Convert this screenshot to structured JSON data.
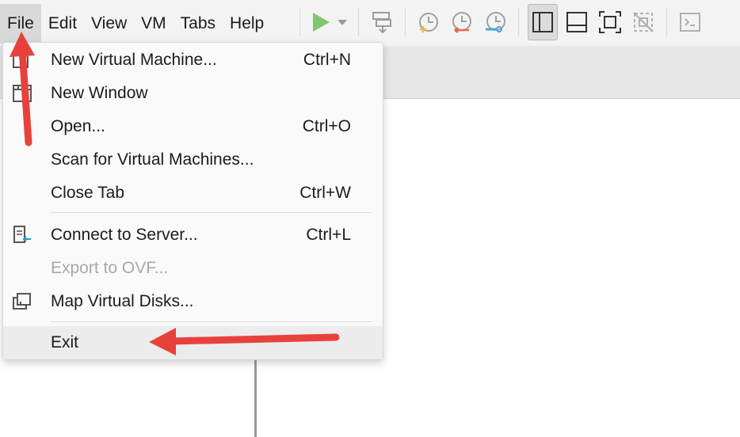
{
  "menubar": {
    "items": [
      {
        "label": "File"
      },
      {
        "label": "Edit"
      },
      {
        "label": "View"
      },
      {
        "label": "VM"
      },
      {
        "label": "Tabs"
      },
      {
        "label": "Help"
      }
    ]
  },
  "toolbar": {
    "icons": [
      "play-icon",
      "dropdown-arrow-icon",
      "send-keys-icon",
      "snapshot-icon",
      "revert-snapshot-icon",
      "snapshot-manager-icon",
      "show-library-icon",
      "show-thumbnail-bar-icon",
      "full-screen-icon",
      "unity-icon",
      "console-view-icon"
    ]
  },
  "file_menu": {
    "items": [
      {
        "label": "New Virtual Machine...",
        "shortcut": "Ctrl+N",
        "icon": "new-vm-icon"
      },
      {
        "label": "New Window",
        "shortcut": "",
        "icon": "new-window-icon"
      },
      {
        "label": "Open...",
        "shortcut": "Ctrl+O",
        "icon": ""
      },
      {
        "label": "Scan for Virtual Machines...",
        "shortcut": "",
        "icon": ""
      },
      {
        "label": "Close Tab",
        "shortcut": "Ctrl+W",
        "icon": ""
      },
      {
        "label": "Connect to Server...",
        "shortcut": "Ctrl+L",
        "icon": "connect-server-icon"
      },
      {
        "label": "Export to OVF...",
        "shortcut": "",
        "icon": "",
        "disabled": true
      },
      {
        "label": "Map Virtual Disks...",
        "shortcut": "",
        "icon": "map-disks-icon"
      },
      {
        "label": "Exit",
        "shortcut": "",
        "icon": ""
      }
    ]
  },
  "colors": {
    "arrow": "#e8413c",
    "play": "#79c26b",
    "accent": "#1e9fc8"
  }
}
